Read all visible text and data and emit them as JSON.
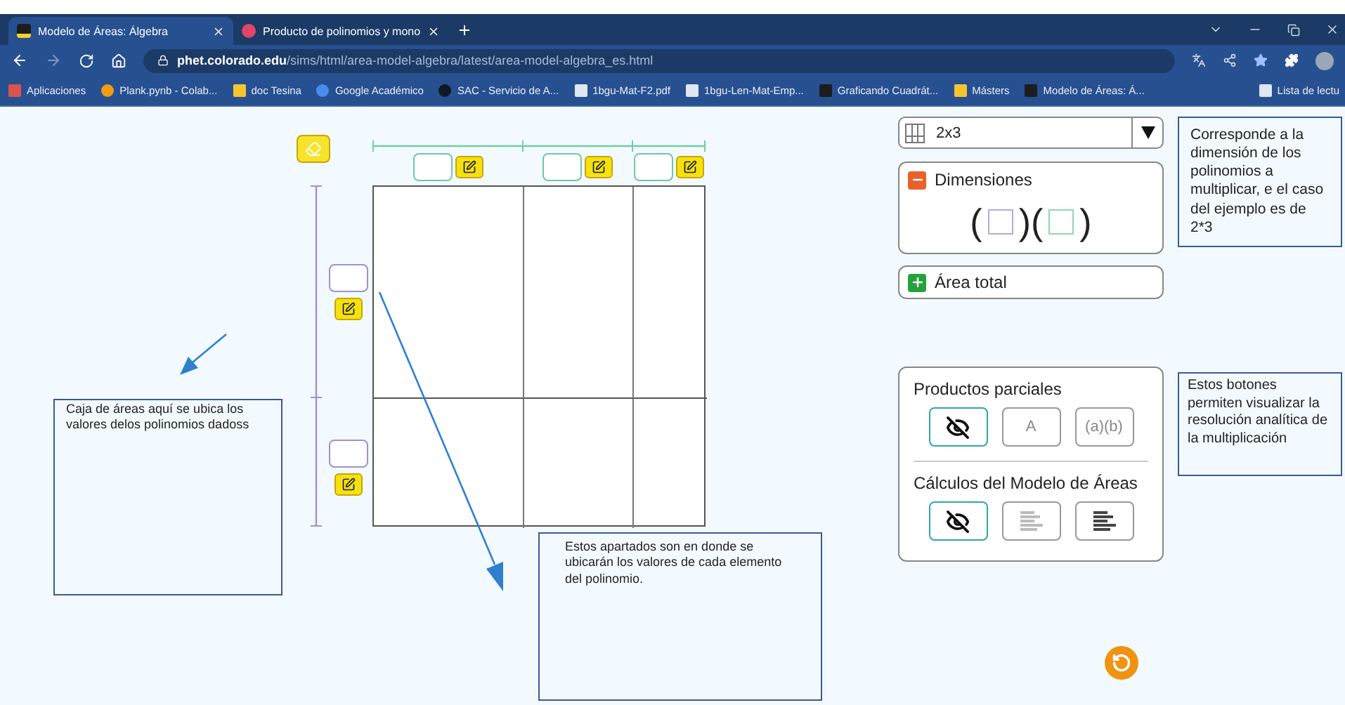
{
  "browser": {
    "tabs": [
      {
        "title": "Modelo de Áreas: Álgebra",
        "kind": "phet",
        "selected": true
      },
      {
        "title": "Producto de polinomios y mono",
        "kind": "red",
        "selected": false
      }
    ],
    "url": "**phet.colorado.edu**/sims/html/area-model-algebra/latest/area-model-algebra_es.html",
    "bookmarks": [
      {
        "label": "Aplicaciones",
        "kind": "apps"
      },
      {
        "label": "Plank.pynb - Colab...",
        "kind": "colab"
      },
      {
        "label": "doc Tesina",
        "kind": "folder"
      },
      {
        "label": "Google Académico",
        "kind": "scholar"
      },
      {
        "label": "SAC - Servicio de A...",
        "kind": "sac"
      },
      {
        "label": "1bgu-Mat-F2.pdf",
        "kind": "doc"
      },
      {
        "label": "1bgu-Len-Mat-Emp...",
        "kind": "doc"
      },
      {
        "label": "Graficando Cuadrát...",
        "kind": "phet"
      },
      {
        "label": "Másters",
        "kind": "folder"
      },
      {
        "label": "Modelo de Áreas: Á...",
        "kind": "phet"
      }
    ],
    "reading_list": "Lista de lectu"
  },
  "area_model": {
    "columns": [
      {
        "kind": "term"
      },
      {
        "kind": "term"
      },
      {
        "kind": "term"
      }
    ],
    "rows": [
      {
        "kind": "term"
      },
      {
        "kind": "term"
      }
    ]
  },
  "layout_select": {
    "value": "2x3"
  },
  "dimensions": {
    "title": "Dimensiones",
    "expanded": true,
    "open": "(",
    "middle": ")(",
    "close": ")"
  },
  "total_area": {
    "title": "Área total",
    "expanded": false
  },
  "partial_products": {
    "title": "Productos parciales",
    "options": [
      {
        "kind": "hidden",
        "selected": true
      },
      {
        "kind": "text",
        "label": "A",
        "selected": false
      },
      {
        "kind": "text",
        "label": "(a)(b)",
        "selected": false
      }
    ]
  },
  "calculations": {
    "title": "Cálculos del Modelo de Áreas",
    "options": [
      {
        "kind": "hidden",
        "selected": true
      },
      {
        "kind": "steps",
        "selected": false
      },
      {
        "kind": "full",
        "selected": false
      }
    ]
  },
  "annotations": [
    {
      "text": "Corresponde a la dimensión de los polinomios a multiplicar, e el caso del ejemplo es de 2*3"
    },
    {
      "text": "Caja de áreas aquí  se  ubica los valores delos polinomios dadoss"
    },
    {
      "text": "Estos botones permiten visualizar la resolución analítica de la multiplicación"
    },
    {
      "text": "Estos apartados son en donde se ubicarán los valores de cada elemento del polinomio."
    }
  ]
}
